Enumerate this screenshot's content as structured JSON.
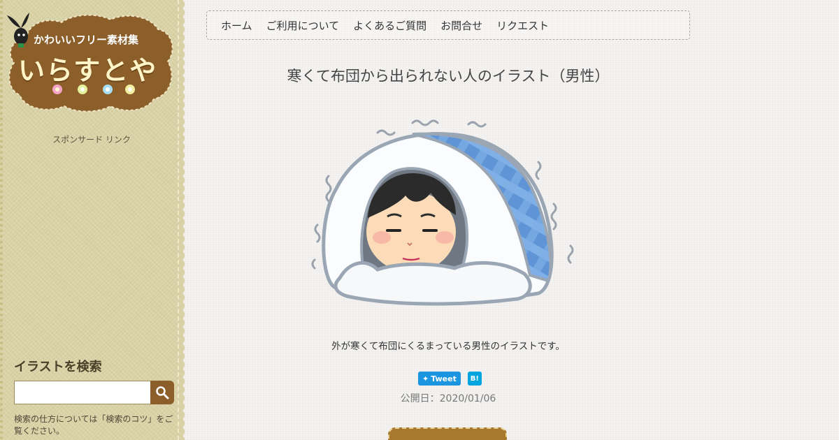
{
  "site": {
    "logo_tagline": "かわいいフリー素材集",
    "logo_name": "いらすとや"
  },
  "sidebar": {
    "sponsor_label": "スポンサード リンク",
    "search_title": "イラストを検索",
    "search_value": "",
    "search_help": "検索の仕方については「検索のコツ」をご覧ください。"
  },
  "nav": {
    "items": [
      {
        "label": "ホーム"
      },
      {
        "label": "ご利用について"
      },
      {
        "label": "よくあるご質問"
      },
      {
        "label": "お問合せ"
      },
      {
        "label": "リクエスト"
      }
    ]
  },
  "post": {
    "title": "寒くて布団から出られない人のイラスト（男性）",
    "caption": "外が寒くて布団にくるまっている男性のイラストです。",
    "tweet_label": "Tweet",
    "hatena_label": "B!",
    "published": "公開日：2020/01/06"
  },
  "colors": {
    "sidebar_bg": "#d9d2a6",
    "logo_brown": "#8b5e2a",
    "tweet_blue": "#1b95e0",
    "hatena_blue": "#00a4de",
    "futon_blue": "#6a9ad8"
  }
}
